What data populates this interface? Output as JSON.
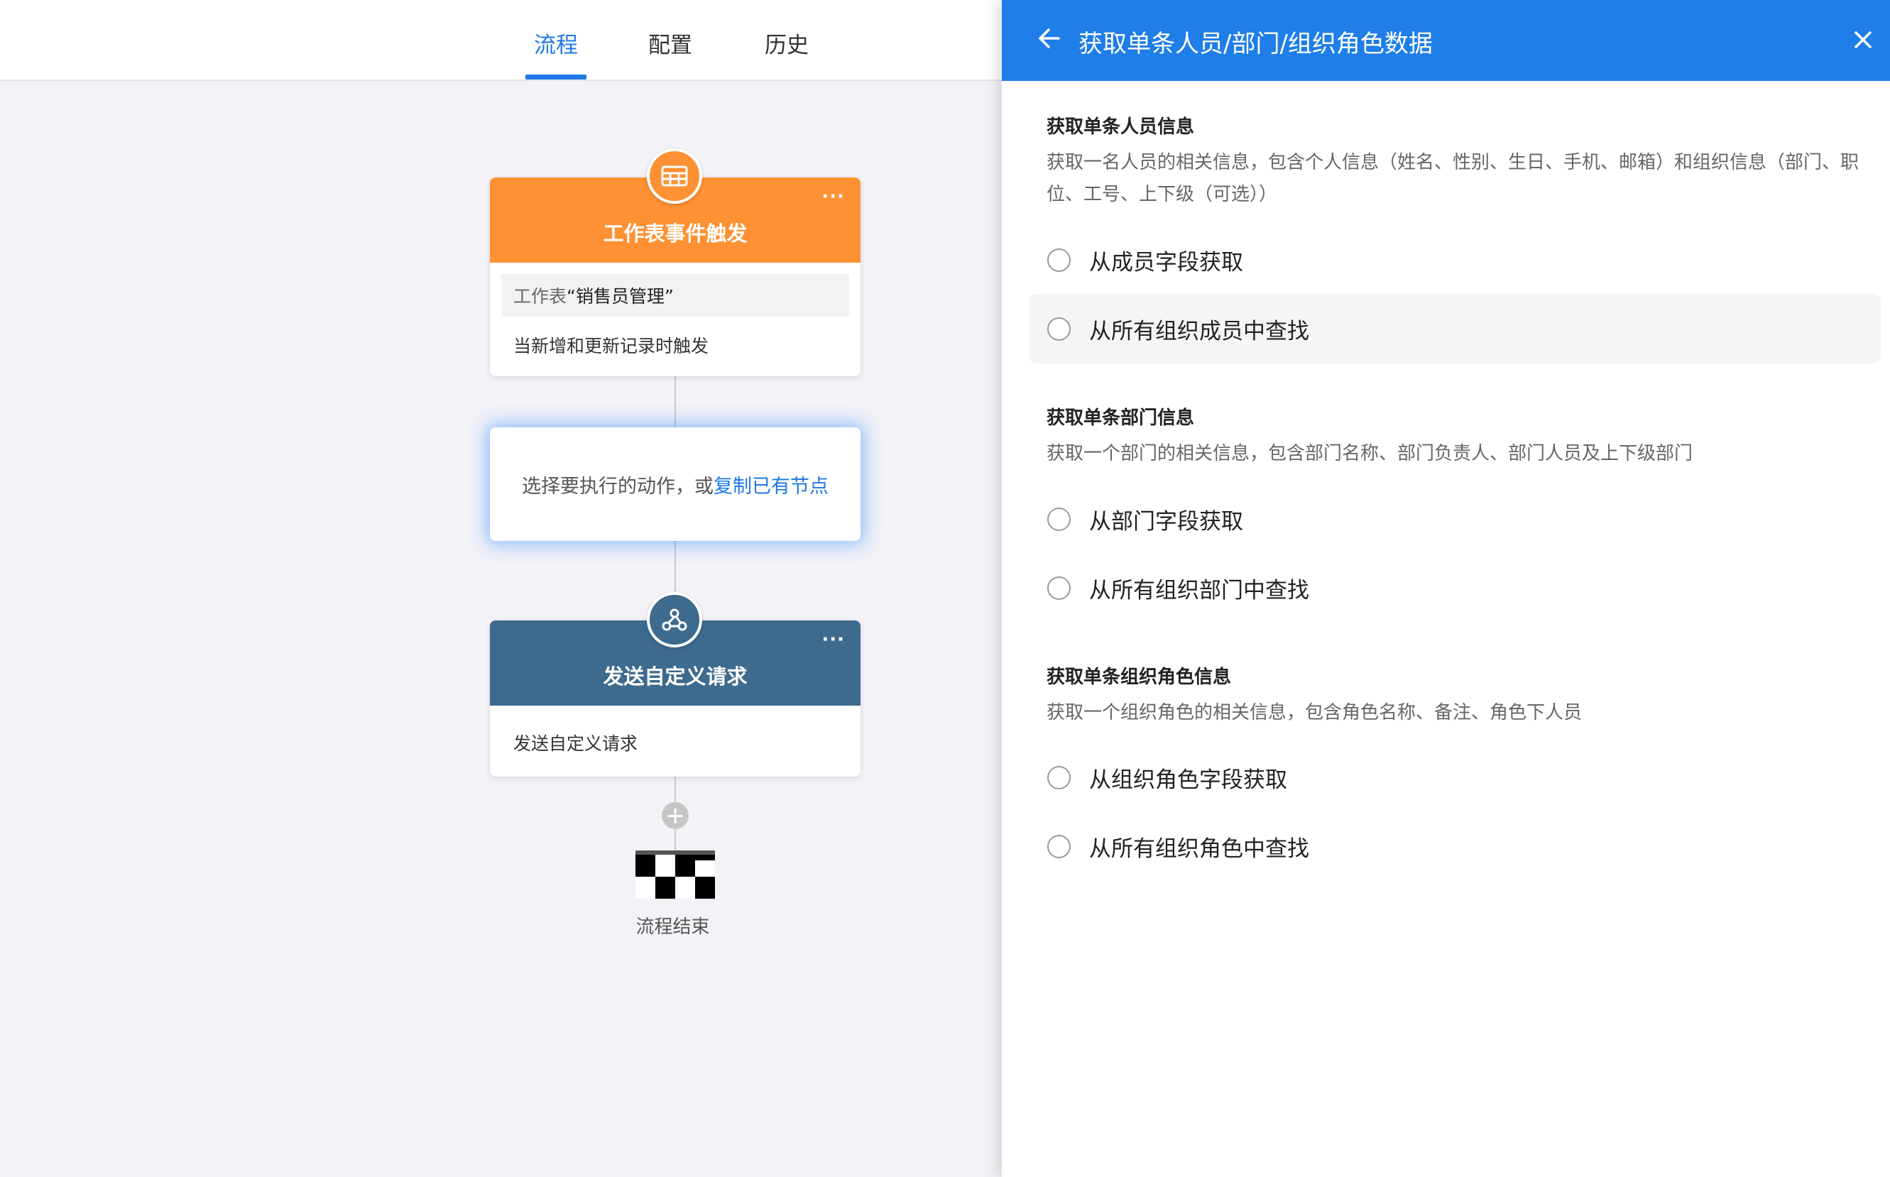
{
  "tabs": [
    {
      "label": "流程",
      "active": true
    },
    {
      "label": "配置",
      "active": false
    },
    {
      "label": "历史",
      "active": false
    }
  ],
  "flow": {
    "trigger": {
      "title": "工作表事件触发",
      "sheet_prefix": "工作表",
      "sheet_name": "“销售员管理”",
      "description": "当新增和更新记录时触发",
      "icon": "table-icon",
      "color": "#fd9133"
    },
    "action_placeholder": {
      "text": "选择要执行的动作，或",
      "link": "复制已有节点"
    },
    "webhook": {
      "title": "发送自定义请求",
      "description": "发送自定义请求",
      "icon": "webhook-icon",
      "color": "#3e6a8e"
    },
    "end_label": "流程结束",
    "more_label": "···",
    "add_label": "+"
  },
  "panel": {
    "title": "获取单条人员/部门/组织角色数据",
    "accent": "#1f7ee8",
    "sections": [
      {
        "title": "获取单条人员信息",
        "desc": "获取一名人员的相关信息，包含个人信息（姓名、性别、生日、手机、邮箱）和组织信息（部门、职位、工号、上下级（可选））",
        "options": [
          "从成员字段获取",
          "从所有组织成员中查找"
        ]
      },
      {
        "title": "获取单条部门信息",
        "desc": "获取一个部门的相关信息，包含部门名称、部门负责人、部门人员及上下级部门",
        "options": [
          "从部门字段获取",
          "从所有组织部门中查找"
        ]
      },
      {
        "title": "获取单条组织角色信息",
        "desc": "获取一个组织角色的相关信息，包含角色名称、备注、角色下人员",
        "options": [
          "从组织角色字段获取",
          "从所有组织角色中查找"
        ]
      }
    ]
  }
}
